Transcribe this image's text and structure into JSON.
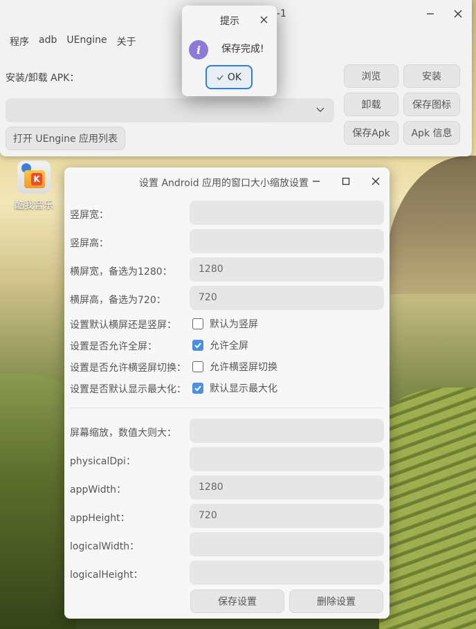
{
  "main_window": {
    "title_fragment": "-1",
    "menu": [
      "程序",
      "adb",
      "UEngine",
      "关于"
    ],
    "apk_label": "安装/卸载 APK：",
    "combo_value": "",
    "buttons": {
      "browse": "浏览",
      "install": "安装",
      "uninstall": "卸载",
      "save_icon": "保存图标",
      "save_apk": "保存Apk",
      "apk_info": "Apk 信息",
      "open_list": "打开 UEngine 应用列表"
    }
  },
  "desktop_icon": {
    "label": "酷我音乐",
    "icon": "kuwo-music-icon"
  },
  "settings_dialog": {
    "title": "设置 Android 应用的窗口大小缩放设置",
    "fields_top": [
      {
        "label": "竖屏宽：",
        "value": ""
      },
      {
        "label": "竖屏高：",
        "value": ""
      },
      {
        "label": "横屏宽，备选为1280：",
        "value": "1280"
      },
      {
        "label": "横屏高，备选为720：",
        "value": "720"
      }
    ],
    "checkbox_rows": [
      {
        "label": "设置默认横屏还是竖屏：",
        "option": "默认为竖屏",
        "checked": false
      },
      {
        "label": "设置是否允许全屏：",
        "option": "允许全屏",
        "checked": true
      },
      {
        "label": "设置是否允许横竖屏切换：",
        "option": "允许横竖屏切换",
        "checked": false
      },
      {
        "label": "设置是否默认显示最大化：",
        "option": "默认显示最大化",
        "checked": true
      }
    ],
    "fields_bottom": [
      {
        "label": "屏幕缩放，数值大则大：",
        "value": ""
      },
      {
        "label": "physicalDpi：",
        "value": ""
      },
      {
        "label": "appWidth：",
        "value": "1280"
      },
      {
        "label": "appHeight：",
        "value": "720"
      },
      {
        "label": "logicalWidth：",
        "value": ""
      },
      {
        "label": "logicalHeight：",
        "value": ""
      }
    ],
    "save_button": "保存设置",
    "delete_button": "删除设置"
  },
  "popup": {
    "title": "提示",
    "message": "保存完成!",
    "ok_label": "OK",
    "icon": "info-icon",
    "accent_color": "#2f7fd8"
  },
  "colors": {
    "checkbox_checked": "#4a90e2",
    "info_icon": "#8c7ad6"
  }
}
